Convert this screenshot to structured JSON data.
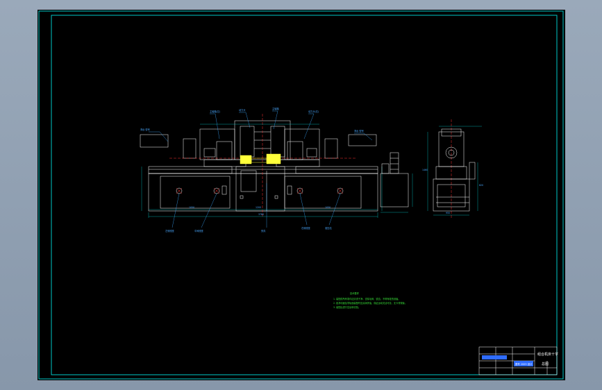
{
  "drawing": {
    "background": "#000000",
    "frame_color": "#00c8c8",
    "line_color": "#ffffff",
    "accent_yellow": "#ffff3a",
    "dim_color": "#00c8c8",
    "leader_color": "#3aa8ff",
    "center_line_color": "#ff3030",
    "note_color": "#38e038"
  },
  "front_view": {
    "labels": {
      "top_1": "主轴箱(左)",
      "top_2": "动力头",
      "top_3": "主轴箱",
      "top_4": "动力头(右)",
      "left_box": "滑台 型号",
      "right_box": "滑台 型号",
      "bottom_1": "左侧底座",
      "bottom_2": "中间底座",
      "bottom_3": "夹具",
      "bottom_4": "右侧底座",
      "bottom_5": "液压站"
    },
    "dimensions": {
      "overall": "3760",
      "left": "1050",
      "mid": "1200",
      "right": "1050"
    }
  },
  "side_view": {
    "dimensions": {
      "width": "950",
      "height": "1460",
      "depth": "820"
    }
  },
  "notes": {
    "title": "技术要求",
    "items": [
      "1. 装配前所有零件应清洗干净，去除毛刺、锐边，不得有碰伤划痕。",
      "2. 各滑动面及导轨面装配时应涂润滑油，保证运动灵活可靠，无卡滞现象。",
      "3. 装配后进行空运转试验。"
    ]
  },
  "title_block": {
    "drawing_name": "组合机床十字 总图",
    "line_1": "组合机床十字",
    "line_2": "总图",
    "scale_label": "比例",
    "sheet_label": "图号 2009 设计"
  }
}
